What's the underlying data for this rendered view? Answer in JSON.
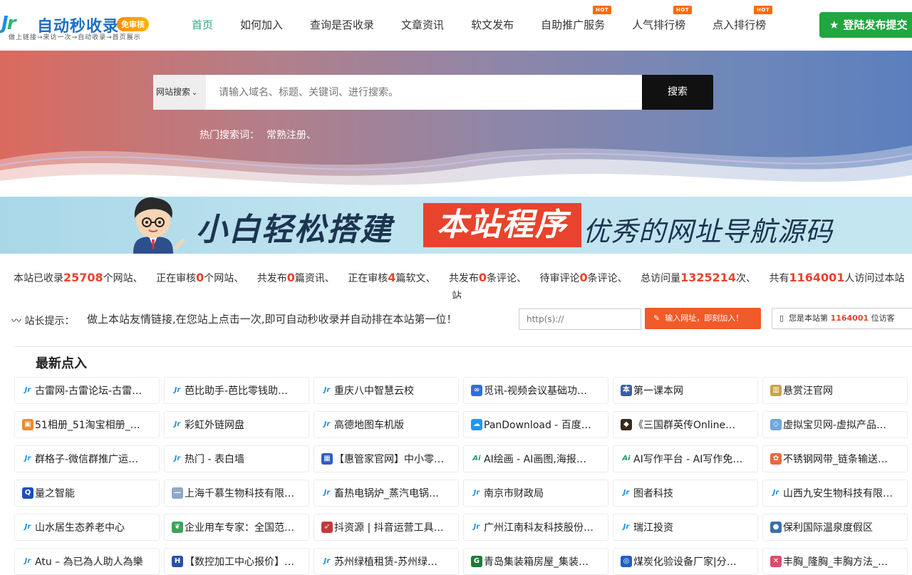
{
  "header": {
    "logo_mark": "Jr",
    "logo_name": "自动秒收录",
    "logo_badge": "免审核",
    "logo_slogan": "做上链接→来访一次→自动收录→首页展示",
    "nav": [
      {
        "label": "首页",
        "active": true,
        "hot": false
      },
      {
        "label": "如何加入",
        "active": false,
        "hot": false
      },
      {
        "label": "查询是否收录",
        "active": false,
        "hot": false
      },
      {
        "label": "文章资讯",
        "active": false,
        "hot": false
      },
      {
        "label": "软文发布",
        "active": false,
        "hot": false
      },
      {
        "label": "自助推广服务",
        "active": false,
        "hot": true
      },
      {
        "label": "人气排行榜",
        "active": false,
        "hot": true
      },
      {
        "label": "点入排行榜",
        "active": false,
        "hot": true
      }
    ],
    "hot_label": "HOT",
    "publish_label": "登陆发布提交"
  },
  "search": {
    "select_value": "网站搜索",
    "placeholder": "请输入域名、标题、关键词、进行搜索。",
    "button": "搜索",
    "hot_label": "热门搜索词：",
    "hot_words": [
      "常熟注册、"
    ]
  },
  "banner": {
    "t1": "小白轻松搭建",
    "t2": "本站程序",
    "t3": "优秀的网址导航源码"
  },
  "stats": {
    "p1": "本站已收录",
    "v1": "25708",
    "s1": "个网站、",
    "p2": "正在审核",
    "v2": "0",
    "s2": "个网站、",
    "p3": "共发布",
    "v3": "0",
    "s3": "篇资讯、",
    "p4": "正在审核",
    "v4": "4",
    "s4": "篇软文、",
    "p5": "共发布",
    "v5": "0",
    "s5": "条评论、",
    "p6": "待审评论",
    "v6": "0",
    "s6": "条评论、",
    "p7": "总访问量",
    "v7": "1325214",
    "s7": "次、",
    "p8": "共有",
    "v8": "1164001",
    "s8": "人访问过本站",
    "wrap": "站"
  },
  "tip": {
    "label": "站长提示：",
    "text": "做上本站友情链接,在您站上点击一次,即可自动秒收录并自动排在本站第一位！",
    "url_placeholder": "http(s)://",
    "join_button": "输入网址，即刻加入！",
    "visitor_prefix": "您是本站第",
    "visitor_count": "1164001",
    "visitor_suffix": "位访客"
  },
  "latest": {
    "title": "最新点入",
    "sites": [
      {
        "name": "古雷网-古雷论坛-古雷…",
        "icon": "jr-logo",
        "color": "#1c8fe0"
      },
      {
        "name": "芭比助手-芭比零钱助…",
        "icon": "jr-logo",
        "color": "#1c8fe0"
      },
      {
        "name": "重庆八中智慧云校",
        "icon": "jr-logo",
        "color": "#1c8fe0"
      },
      {
        "name": "觅讯-视频会议基础功…",
        "icon": "link-icon",
        "color": "#2f6fe0"
      },
      {
        "name": "第一课本网",
        "icon": "book-icon",
        "color": "#3a5fa8"
      },
      {
        "name": "悬赏汪官网",
        "icon": "stripe-icon",
        "color": "#c9a24a"
      },
      {
        "name": "51相册_51淘宝相册_…",
        "icon": "album-icon",
        "color": "#f0892b"
      },
      {
        "name": "彩虹外链网盘",
        "icon": "jr-logo",
        "color": "#1c8fe0"
      },
      {
        "name": "高德地图车机版",
        "icon": "jr-logo",
        "color": "#1c8fe0"
      },
      {
        "name": "PanDownload - 百度…",
        "icon": "cloud-icon",
        "color": "#2196f3"
      },
      {
        "name": "《三国群英传Online…",
        "icon": "game-icon",
        "color": "#3a2a1a"
      },
      {
        "name": "虚拟宝贝网-虚拟产品…",
        "icon": "gem-icon",
        "color": "#6ea8de"
      },
      {
        "name": "群格子-微信群推广运…",
        "icon": "jr-logo",
        "color": "#1c8fe0"
      },
      {
        "name": "热门 - 表白墙",
        "icon": "jr-logo",
        "color": "#1c8fe0"
      },
      {
        "name": "【惠管家官网】中小零…",
        "icon": "grid-icon",
        "color": "#2f5fc0"
      },
      {
        "name": "AI绘画 - AI画图,海报…",
        "icon": "ai-icon",
        "color": "#1d9b6c"
      },
      {
        "name": "AI写作平台 - AI写作免…",
        "icon": "ai-icon",
        "color": "#1d9b6c"
      },
      {
        "name": "不锈钢网带_链条输送…",
        "icon": "flower-icon",
        "color": "#e86a3a"
      },
      {
        "name": "量之智能",
        "icon": "q-icon",
        "color": "#1a4fbf"
      },
      {
        "name": "上海千慕生物科技有限…",
        "icon": "line-icon",
        "color": "#8fa8c8"
      },
      {
        "name": "畜热电锅炉_蒸汽电锅…",
        "icon": "jr-logo",
        "color": "#1c8fe0"
      },
      {
        "name": "南京市财政局",
        "icon": "jr-logo",
        "color": "#1c8fe0"
      },
      {
        "name": "图者科技",
        "icon": "jr-logo",
        "color": "#1c8fe0"
      },
      {
        "name": "山西九安生物科技有限…",
        "icon": "jr-logo",
        "color": "#1c8fe0"
      },
      {
        "name": "山水居生态养老中心",
        "icon": "jr-logo",
        "color": "#1c8fe0"
      },
      {
        "name": "企业用车专家：全国范…",
        "icon": "leaf-icon",
        "color": "#3aa35a"
      },
      {
        "name": "抖资源 | 抖音运营工具…",
        "icon": "rocket-icon",
        "color": "#c43a3a"
      },
      {
        "name": "广州江南科友科技股份…",
        "icon": "jr-logo",
        "color": "#1c8fe0"
      },
      {
        "name": "瑞江投资",
        "icon": "jr-logo",
        "color": "#1c8fe0"
      },
      {
        "name": "保利国际温泉度假区",
        "icon": "drop-icon",
        "color": "#3a6fa8"
      },
      {
        "name": "Atu – 為已為人助人為樂",
        "icon": "jr-logo",
        "color": "#1c8fe0"
      },
      {
        "name": "【数控加工中心报价】…",
        "icon": "h-icon",
        "color": "#2a4fa8"
      },
      {
        "name": "苏州绿植租赁-苏州绿…",
        "icon": "jr-logo",
        "color": "#1c8fe0"
      },
      {
        "name": "青岛集装箱房屋_集装…",
        "icon": "g-icon",
        "color": "#1f7a3a"
      },
      {
        "name": "煤炭化验设备厂家|分…",
        "icon": "globe-icon",
        "color": "#1f5fc0"
      },
      {
        "name": "丰胸_隆胸_丰胸方法_…",
        "icon": "x-icon",
        "color": "#e04a6a"
      }
    ]
  }
}
